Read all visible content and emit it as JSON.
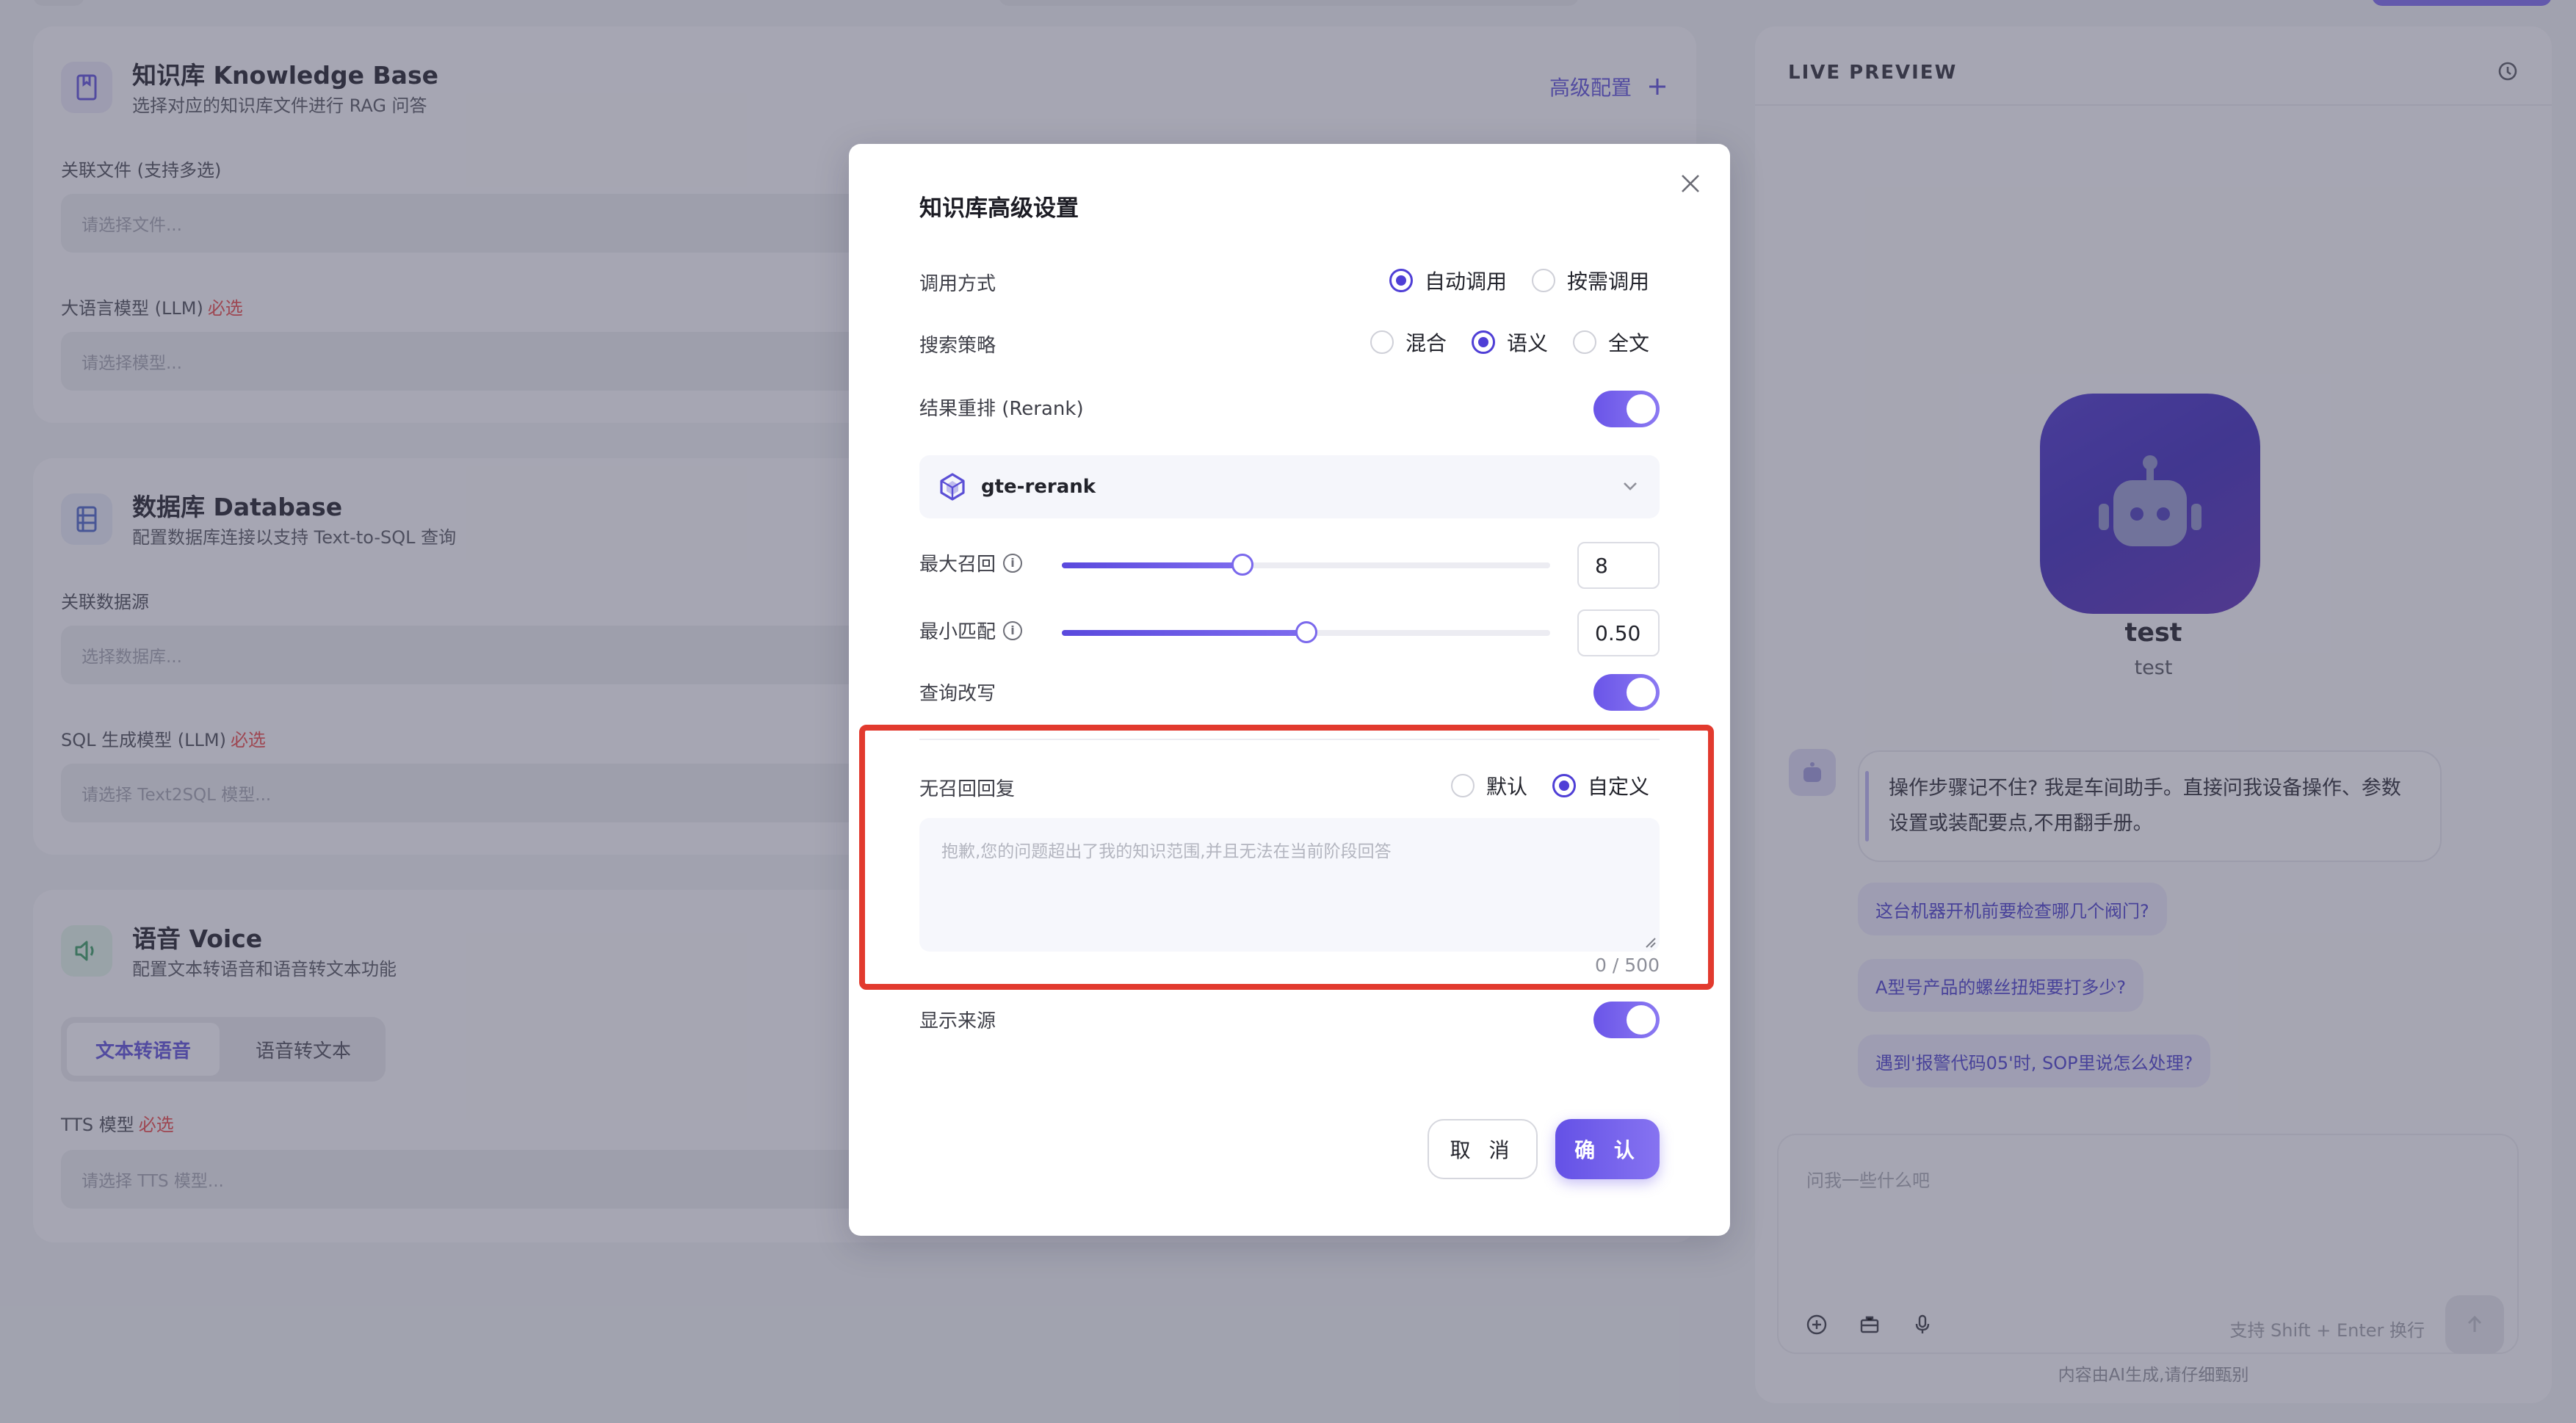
{
  "background": {
    "knowledge_card": {
      "title": "知识库 Knowledge Base",
      "subtitle": "选择对应的知识库文件进行 RAG 问答",
      "advanced_link": "高级配置",
      "files_label": "关联文件 (支持多选)",
      "files_placeholder": "请选择文件...",
      "llm_label": "大语言模型 (LLM)",
      "llm_required": "必选",
      "llm_placeholder": "请选择模型..."
    },
    "database_card": {
      "title": "数据库 Database",
      "subtitle": "配置数据库连接以支持 Text-to-SQL 查询",
      "source_label": "关联数据源",
      "source_placeholder": "选择数据库...",
      "sql_label": "SQL 生成模型 (LLM)",
      "sql_required": "必选",
      "sql_placeholder": "请选择 Text2SQL 模型..."
    },
    "voice_card": {
      "title": "语音 Voice",
      "subtitle": "配置文本转语音和语音转文本功能",
      "tabs": [
        "文本转语音",
        "语音转文本"
      ],
      "active_tab": 0,
      "tts_label": "TTS 模型",
      "tts_required": "必选",
      "tts_placeholder": "请选择 TTS 模型..."
    },
    "preview": {
      "title": "LIVE PREVIEW",
      "bot_name": "test",
      "bot_desc": "test",
      "greeting": "操作步骤记不住? 我是车间助手。直接问我设备操作、参数设置或装配要点,不用翻手册。",
      "suggestions": [
        "这台机器开机前要检查哪几个阀门?",
        "A型号产品的螺丝扭矩要打多少?",
        "遇到'报警代码05'时, SOP里说怎么处理?"
      ],
      "input_placeholder": "问我一些什么吧",
      "input_hint": "支持 Shift + Enter 换行",
      "disclaimer": "内容由AI生成,请仔细甄别"
    }
  },
  "modal": {
    "title": "知识库高级设置",
    "call_mode": {
      "label": "调用方式",
      "options": [
        "自动调用",
        "按需调用"
      ],
      "selected": 0
    },
    "search_strategy": {
      "label": "搜索策略",
      "options": [
        "混合",
        "语义",
        "全文"
      ],
      "selected": 1
    },
    "rerank": {
      "label": "结果重排 (Rerank)",
      "enabled": true,
      "model": "gte-rerank"
    },
    "max_recall": {
      "label": "最大召回",
      "value": "8",
      "fraction": 0.37
    },
    "min_match": {
      "label": "最小匹配",
      "value": "0.50",
      "fraction": 0.5
    },
    "query_rewrite": {
      "label": "查询改写",
      "enabled": true
    },
    "no_recall_reply": {
      "label": "无召回回复",
      "options": [
        "默认",
        "自定义"
      ],
      "selected": 1,
      "placeholder": "抱歉,您的问题超出了我的知识范围,并且无法在当前阶段回答",
      "counter": "0 / 500"
    },
    "show_source": {
      "label": "显示来源",
      "enabled": true
    },
    "cancel_label": "取 消",
    "confirm_label": "确 认"
  },
  "colors": {
    "accent": "#4f3fd6",
    "highlight": "#e23a2e",
    "required": "#e54848"
  }
}
